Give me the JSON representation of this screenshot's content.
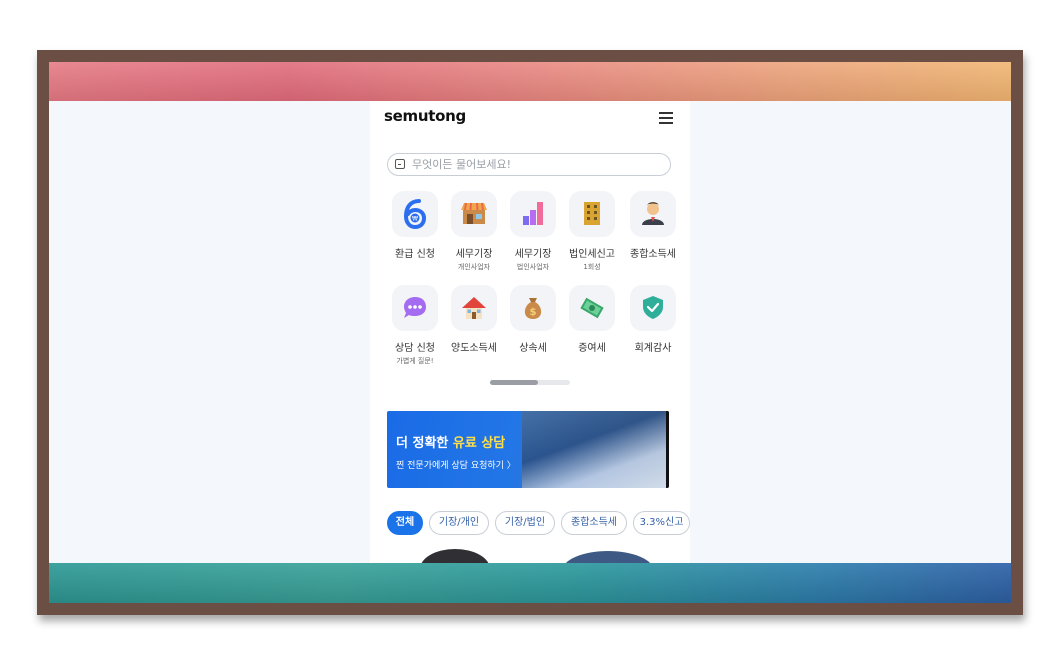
{
  "header": {
    "logo": "semutong"
  },
  "search": {
    "placeholder": "무엇이든 물어보세요!"
  },
  "categories_row1": [
    {
      "label": "환급 신청",
      "sub": "",
      "icon": "refund-6-icon"
    },
    {
      "label": "세무기장",
      "sub": "개인사업자",
      "icon": "storefront-icon"
    },
    {
      "label": "세무기장",
      "sub": "법인사업자",
      "icon": "bar-chart-icon"
    },
    {
      "label": "법인세신고",
      "sub": "1회성",
      "icon": "building-icon"
    },
    {
      "label": "종합소득세",
      "sub": "",
      "icon": "person-icon"
    }
  ],
  "categories_row2": [
    {
      "label": "상담 신청",
      "sub": "가볍게 질문!",
      "icon": "chat-bubble-icon"
    },
    {
      "label": "양도소득세",
      "sub": "",
      "icon": "house-icon"
    },
    {
      "label": "상속세",
      "sub": "",
      "icon": "money-bag-icon"
    },
    {
      "label": "증여세",
      "sub": "",
      "icon": "cash-icon"
    },
    {
      "label": "회계감사",
      "sub": "",
      "icon": "shield-check-icon"
    }
  ],
  "banner": {
    "title_prefix": "더 정확한 ",
    "title_highlight": "유료 상담",
    "cta": "찐 전문가에게 상담 요청하기  〉"
  },
  "filter_chips": [
    "전체",
    "기장/개인",
    "기장/법인",
    "종합소득세",
    "3.3%신고"
  ],
  "colors": {
    "accent": "#1a73e8",
    "chip_text": "#335fa8",
    "banner_highlight": "#ffe04a"
  }
}
